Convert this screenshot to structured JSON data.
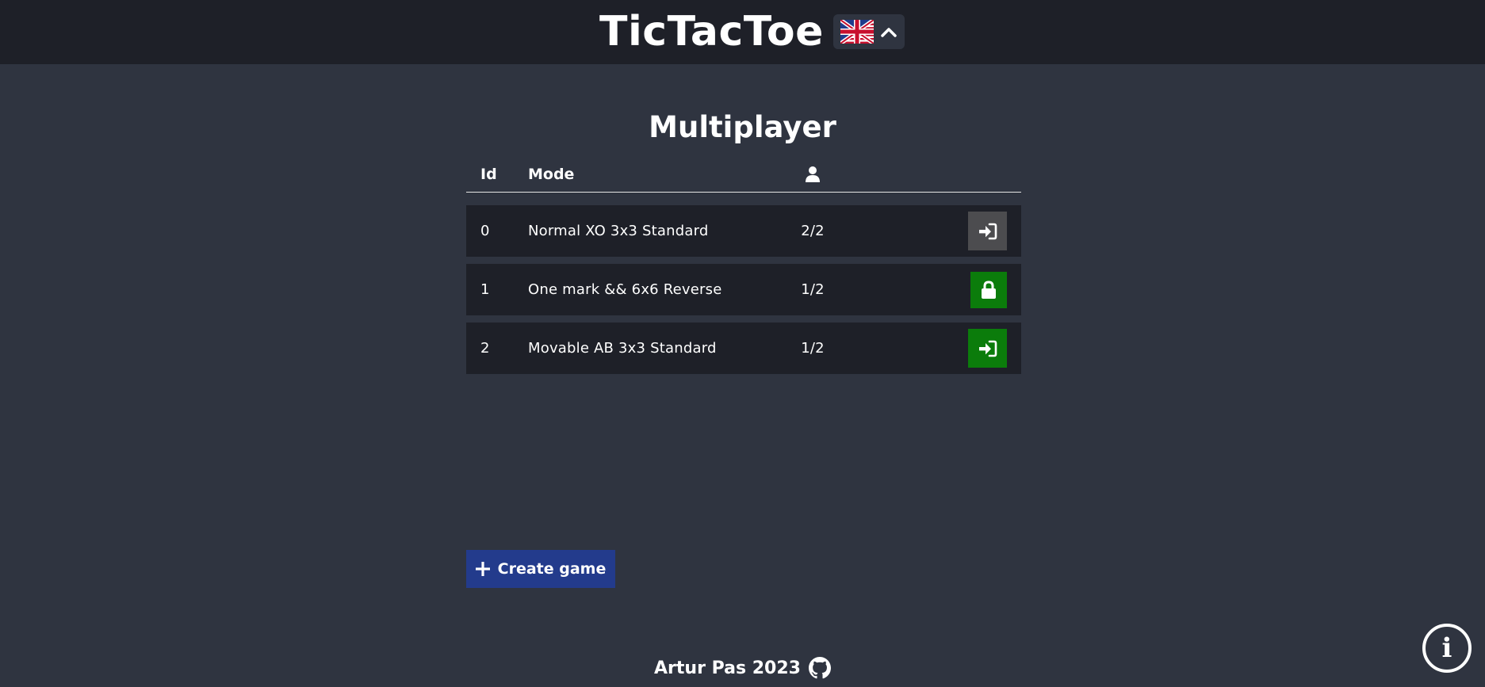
{
  "header": {
    "title": "TicTacToe",
    "language_flag_icon": "uk-us-flag-icon",
    "language_chevron_icon": "chevron-up-icon"
  },
  "main": {
    "title": "Multiplayer",
    "table": {
      "columns": {
        "id": "Id",
        "mode": "Mode",
        "players_icon": "user-icon"
      },
      "rows": [
        {
          "id": "0",
          "mode": "Normal XO 3x3 Standard",
          "players": "2/2",
          "action_icon": "sign-in-icon",
          "action_color": "#4c4c4f"
        },
        {
          "id": "1",
          "mode": "One mark && 6x6 Reverse",
          "players": "1/2",
          "action_icon": "lock-icon",
          "action_color": "#0b7c0b"
        },
        {
          "id": "2",
          "mode": "Movable AB 3x3 Standard",
          "players": "1/2",
          "action_icon": "sign-in-icon",
          "action_color": "#0b7c0b"
        }
      ]
    },
    "create_button": {
      "label": "Create game",
      "icon": "plus-icon",
      "color": "#233b8c"
    }
  },
  "footer": {
    "text": "Artur Pas 2023",
    "icon": "github-icon"
  },
  "info_button": {
    "icon": "info-icon",
    "glyph": "i"
  },
  "colors": {
    "background": "#2f3440",
    "header": "#1e2028",
    "row": "#1e2028"
  }
}
